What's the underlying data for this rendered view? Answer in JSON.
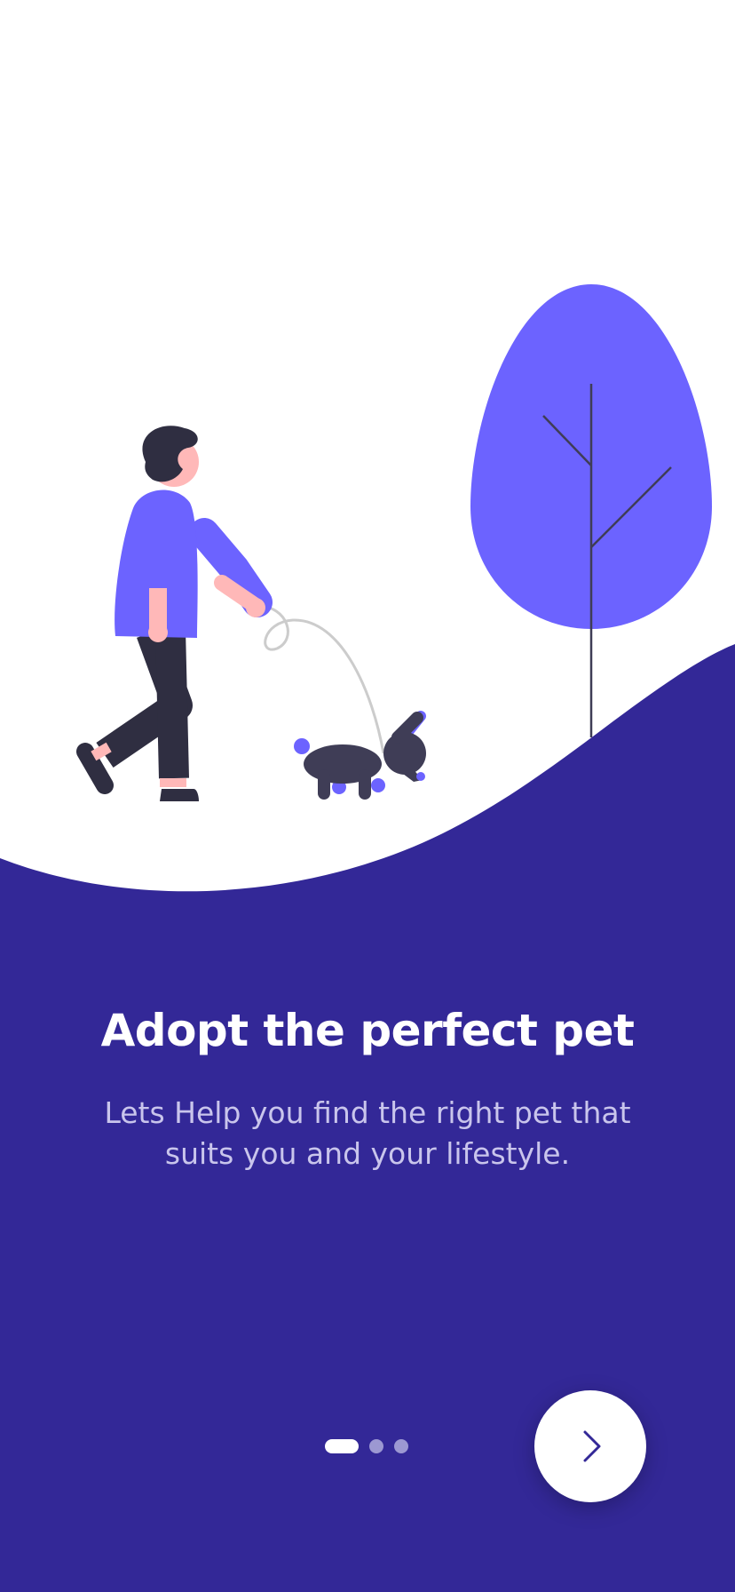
{
  "colors": {
    "background": "#ffffff",
    "wave": "#332897",
    "accent": "#6c63ff",
    "dark": "#3f3d56",
    "skin": "#ffb8b8",
    "leash": "#cccccc",
    "pager_inactive": "#9c98d2",
    "pager_active": "#ffffff"
  },
  "onboarding": {
    "title": "Adopt the perfect pet",
    "subtitle": "Lets Help you find the right pet that suits you and your lifestyle.",
    "pager": {
      "total_pages": 3,
      "current_page": 1
    },
    "next_button_icon": "chevron-right-icon"
  },
  "illustration": {
    "icons": [
      "person-walking-dog-illustration",
      "tree-illustration",
      "dog-illustration"
    ]
  }
}
